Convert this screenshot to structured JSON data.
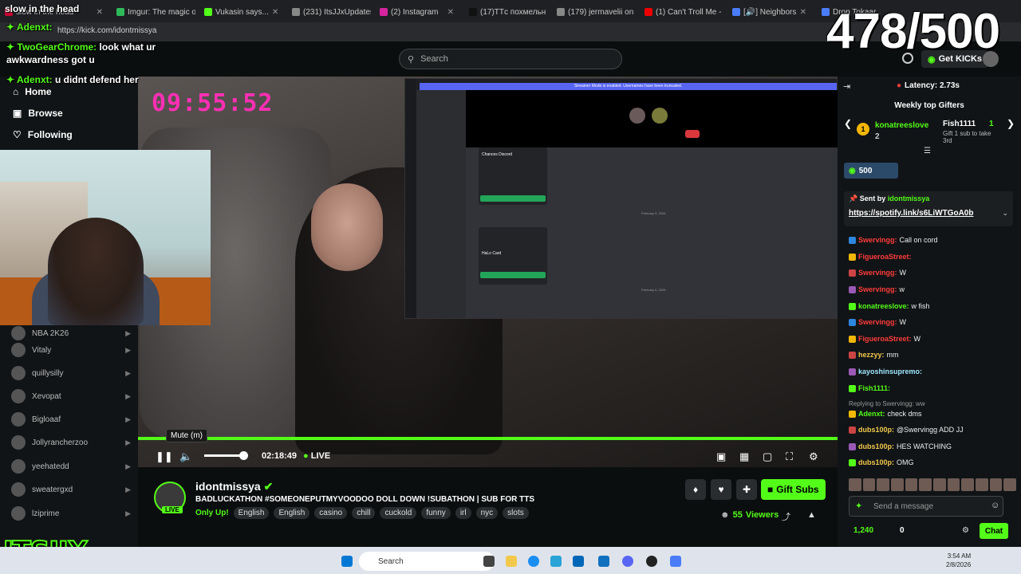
{
  "browser": {
    "tabs": [
      {
        "label": "slow in the head",
        "fav": "#c03"
      },
      {
        "label": "Imgur: The magic of",
        "fav": "#2fba5a"
      },
      {
        "label": "Vukasin says...",
        "fav": "#53fc18"
      },
      {
        "label": "(231) ItsJJxUpdates o",
        "fav": "#888"
      },
      {
        "label": "(2) Instagram",
        "fav": "#d6249f"
      },
      {
        "label": "(17)TTс похмельн",
        "fav": "#111"
      },
      {
        "label": "(179) jermavelii on X",
        "fav": "#888"
      },
      {
        "label": "(1) Can't Troll Me - Y",
        "fav": "#e00"
      },
      {
        "label": "[🔊] Neighbors",
        "fav": "#4a7cf7"
      },
      {
        "label": "Drop Tokaar",
        "fav": "#4a7cf7"
      }
    ],
    "url": "https://kick.com/idontmissya"
  },
  "counter": "478/500",
  "header": {
    "search_placeholder": "Search",
    "get_kicks": "Get KICKs"
  },
  "overlay_chat": [
    {
      "user": "TwoGearChrome:",
      "text": "look what ur",
      "line2": "awkwardness got u",
      "color": "#53fc18"
    },
    {
      "user": "Adenxt:",
      "text": "u didnt defend her",
      "color": "#53fc18"
    },
    {
      "user": "Adenxt:",
      "text": "",
      "color": "#53fc18"
    }
  ],
  "sidebar": {
    "nav": [
      {
        "label": "Home",
        "icon": "home-icon"
      },
      {
        "label": "Browse",
        "icon": "browse-icon"
      },
      {
        "label": "Following",
        "icon": "heart-icon"
      }
    ],
    "channels": [
      "NBA 2K26",
      "Vitaly",
      "quillysilly",
      "Xevopat",
      "Bigloaaf",
      "Jollyrancherzoo",
      "yeehatedd",
      "sweatergxd",
      "lziprime"
    ]
  },
  "video": {
    "clock_overlay": "09:55:52",
    "discord_banner": "Streamer Mode is enabled. Usernames have been truncated.",
    "discord_date1": "February 5, 2026",
    "discord_date2": "February 6, 2026",
    "card1": "Chances Discord",
    "card2": "HaLo Card"
  },
  "player": {
    "tooltip": "Mute (m)",
    "time": "02:18:49",
    "live": "LIVE",
    "volume_level": 0.8
  },
  "stream": {
    "name": "idontmissya",
    "title": "BADLUCKATHON #SOMEONEPUTMYVOODOO DOLL DOWN !SUBATHON | SUB FOR TTS",
    "category": "Only Up!",
    "tags": [
      "English",
      "English",
      "casino",
      "chill",
      "cuckold",
      "funny",
      "irl",
      "nyc",
      "slots"
    ],
    "gift_subs": "Gift Subs",
    "viewers": "55",
    "viewers_label": "Viewers",
    "live_badge": "LIVE"
  },
  "chat": {
    "latency": "Latency: 2.73s",
    "weekly_title": "Weekly top Gifters",
    "gifter1": {
      "rank": "1",
      "name": "konatreeslove",
      "count": "2"
    },
    "gifter2": {
      "name": "Fish1111",
      "count": "1",
      "note": "Gift 1 sub to take 3rd"
    },
    "kicks_amount": "500",
    "pinned": {
      "sent_by": "Sent by",
      "user": "idontmissya",
      "link": "https://spotify.link/s6LiWTGoA0b"
    },
    "messages": [
      {
        "user": "Swervingg:",
        "text": "Call on cord",
        "color": "#ff3b3b"
      },
      {
        "user": "FigueroaStreet:",
        "text": "",
        "color": "#ff3b3b"
      },
      {
        "user": "Swervingg:",
        "text": "W",
        "color": "#ff3b3b"
      },
      {
        "user": "Swervingg:",
        "text": "w",
        "color": "#ff3b3b"
      },
      {
        "user": "konatreeslove:",
        "text": "w fish",
        "color": "#53fc18"
      },
      {
        "user": "Swervingg:",
        "text": "W",
        "color": "#ff3b3b"
      },
      {
        "user": "FigueroaStreet:",
        "text": "W",
        "color": "#ff3b3b"
      },
      {
        "user": "hezzyy:",
        "text": "mm",
        "color": "#f2c94c"
      },
      {
        "user": "kayoshinsupremo:",
        "text": "",
        "color": "#9ee7ff"
      },
      {
        "user": "Fish1111:",
        "text": "",
        "color": "#53fc18"
      },
      {
        "user": "",
        "text": "Replying to Swervingg: ww",
        "color": "#999"
      },
      {
        "user": "Adenxt:",
        "text": "check dms",
        "color": "#53fc18"
      },
      {
        "user": "dubs100p:",
        "text": "@Swervingg ADD JJ",
        "color": "#f2c94c"
      },
      {
        "user": "dubs100p:",
        "text": "HES WATCHING",
        "color": "#f2c94c"
      },
      {
        "user": "dubs100p:",
        "text": "OMG",
        "color": "#f2c94c"
      }
    ],
    "send_placeholder": "Send a message",
    "points": "1,240",
    "points2": "0",
    "chat_button": "Chat"
  },
  "taskbar": {
    "search": "Search",
    "time": "3:54 AM",
    "date": "2/8/2026"
  },
  "logo_text": "ITSJJX"
}
